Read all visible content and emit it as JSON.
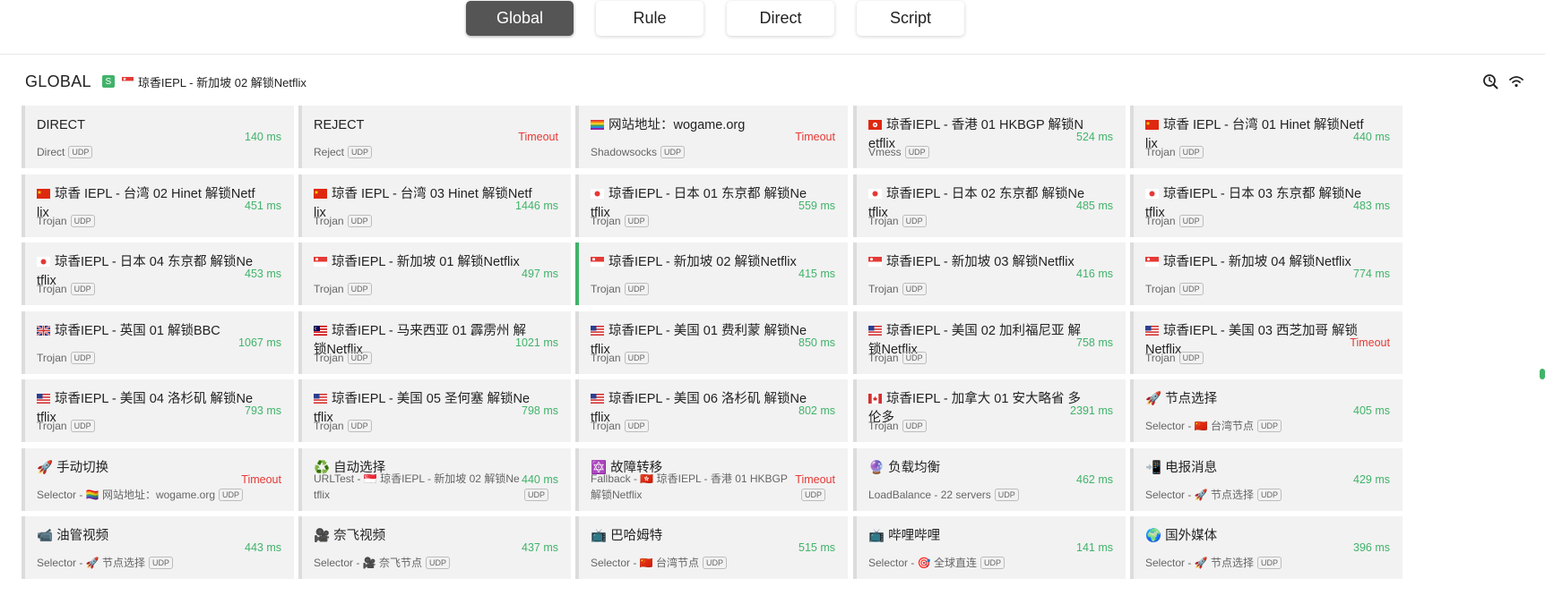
{
  "modes": {
    "tabs": [
      {
        "label": "Global",
        "active": true
      },
      {
        "label": "Rule",
        "active": false
      },
      {
        "label": "Direct",
        "active": false
      },
      {
        "label": "Script",
        "active": false
      }
    ]
  },
  "group": {
    "title": "GLOBAL",
    "type_badge": "S",
    "now_flag": "sg",
    "now": "琼香IEPL - 新加坡 02 解锁Netflix",
    "icons": [
      "check-delay-icon",
      "network-icon"
    ]
  },
  "colors": {
    "accent": "#41b36a",
    "timeout": "#e53935",
    "active_mode": "#555555"
  },
  "proxies": [
    {
      "name": "DIRECT",
      "flag": "",
      "info": "Direct",
      "delay": "140 ms",
      "timeout": false,
      "selected": false
    },
    {
      "name": "REJECT",
      "flag": "",
      "info": "Reject",
      "delay": "Timeout",
      "timeout": true,
      "selected": false
    },
    {
      "name": "网站地址：wogame.org",
      "flag": "rainbow",
      "info": "Shadowsocks",
      "delay": "Timeout",
      "timeout": true,
      "selected": false
    },
    {
      "name": "琼香IEPL - 香港 01 HKBGP 解锁Netflix",
      "flag": "hk",
      "info": "Vmess",
      "delay": "524 ms",
      "timeout": false,
      "selected": false
    },
    {
      "name": "琼香 IEPL - 台湾 01 Hinet 解锁Netflix",
      "flag": "cn",
      "info": "Trojan",
      "delay": "440 ms",
      "timeout": false,
      "selected": false
    },
    {
      "name": "琼香 IEPL - 台湾 02 Hinet 解锁Netflix",
      "flag": "cn",
      "info": "Trojan",
      "delay": "451 ms",
      "timeout": false,
      "selected": false
    },
    {
      "name": "琼香 IEPL - 台湾 03 Hinet 解锁Netflix",
      "flag": "cn",
      "info": "Trojan",
      "delay": "1446 ms",
      "timeout": false,
      "selected": false
    },
    {
      "name": "琼香IEPL - 日本 01 东京都 解锁Netflix",
      "flag": "jp",
      "info": "Trojan",
      "delay": "559 ms",
      "timeout": false,
      "selected": false
    },
    {
      "name": "琼香IEPL - 日本 02 东京都 解锁Netflix",
      "flag": "jp",
      "info": "Trojan",
      "delay": "485 ms",
      "timeout": false,
      "selected": false
    },
    {
      "name": "琼香IEPL - 日本 03 东京都 解锁Netflix",
      "flag": "jp",
      "info": "Trojan",
      "delay": "483 ms",
      "timeout": false,
      "selected": false
    },
    {
      "name": "琼香IEPL - 日本 04 东京都 解锁Netflix",
      "flag": "jp",
      "info": "Trojan",
      "delay": "453 ms",
      "timeout": false,
      "selected": false
    },
    {
      "name": "琼香IEPL - 新加坡 01 解锁Netflix",
      "flag": "sg",
      "info": "Trojan",
      "delay": "497 ms",
      "timeout": false,
      "selected": false
    },
    {
      "name": "琼香IEPL - 新加坡 02 解锁Netflix",
      "flag": "sg",
      "info": "Trojan",
      "delay": "415 ms",
      "timeout": false,
      "selected": true
    },
    {
      "name": "琼香IEPL - 新加坡 03 解锁Netflix",
      "flag": "sg",
      "info": "Trojan",
      "delay": "416 ms",
      "timeout": false,
      "selected": false
    },
    {
      "name": "琼香IEPL - 新加坡 04 解锁Netflix",
      "flag": "sg",
      "info": "Trojan",
      "delay": "774 ms",
      "timeout": false,
      "selected": false
    },
    {
      "name": "琼香IEPL - 英国 01 解锁BBC",
      "flag": "gb",
      "info": "Trojan",
      "delay": "1067 ms",
      "timeout": false,
      "selected": false
    },
    {
      "name": "琼香IEPL - 马来西亚 01 霹雳州 解锁Netflix",
      "flag": "my",
      "info": "Trojan",
      "delay": "1021 ms",
      "timeout": false,
      "selected": false
    },
    {
      "name": "琼香IEPL - 美国 01 费利蒙 解锁Netflix",
      "flag": "us",
      "info": "Trojan",
      "delay": "850 ms",
      "timeout": false,
      "selected": false
    },
    {
      "name": "琼香IEPL - 美国 02 加利福尼亚 解锁Netflix",
      "flag": "us",
      "info": "Trojan",
      "delay": "758 ms",
      "timeout": false,
      "selected": false
    },
    {
      "name": "琼香IEPL - 美国 03 西芝加哥 解锁Netflix",
      "flag": "us",
      "info": "Trojan",
      "delay": "Timeout",
      "timeout": true,
      "selected": false
    },
    {
      "name": "琼香IEPL - 美国 04 洛杉矶 解锁Netflix",
      "flag": "us",
      "info": "Trojan",
      "delay": "793 ms",
      "timeout": false,
      "selected": false
    },
    {
      "name": "琼香IEPL - 美国 05 圣何塞 解锁Netflix",
      "flag": "us",
      "info": "Trojan",
      "delay": "798 ms",
      "timeout": false,
      "selected": false
    },
    {
      "name": "琼香IEPL - 美国 06 洛杉矶 解锁Netflix",
      "flag": "us",
      "info": "Trojan",
      "delay": "802 ms",
      "timeout": false,
      "selected": false
    },
    {
      "name": "琼香IEPL - 加拿大 01 安大略省 多伦多",
      "flag": "ca",
      "info": "Trojan",
      "delay": "2391 ms",
      "timeout": false,
      "selected": false
    },
    {
      "name": "🚀 节点选择",
      "flag": "",
      "info": "Selector - 🇨🇳 台湾节点",
      "delay": "405 ms",
      "timeout": false,
      "selected": false
    },
    {
      "name": "🚀 手动切换",
      "flag": "",
      "info": "Selector - 🏳️‍🌈 网站地址：wogame.org",
      "delay": "Timeout",
      "timeout": true,
      "selected": false
    },
    {
      "name": "♻️ 自动选择",
      "flag": "",
      "info": "URLTest - 🇸🇬 琼香IEPL - 新加坡 02 解锁Netflix",
      "delay": "440 ms",
      "timeout": false,
      "selected": false
    },
    {
      "name": "🔯 故障转移",
      "flag": "",
      "info": "Fallback - 🇭🇰 琼香IEPL - 香港 01 HKBGP 解锁Netflix",
      "delay": "Timeout",
      "timeout": true,
      "selected": false
    },
    {
      "name": "🔮 负载均衡",
      "flag": "",
      "info": "LoadBalance - 22 servers",
      "delay": "462 ms",
      "timeout": false,
      "selected": false
    },
    {
      "name": "📲 电报消息",
      "flag": "",
      "info": "Selector - 🚀 节点选择",
      "delay": "429 ms",
      "timeout": false,
      "selected": false
    },
    {
      "name": "📹 油管视频",
      "flag": "",
      "info": "Selector - 🚀 节点选择",
      "delay": "443 ms",
      "timeout": false,
      "selected": false
    },
    {
      "name": "🎥 奈飞视频",
      "flag": "",
      "info": "Selector - 🎥 奈飞节点",
      "delay": "437 ms",
      "timeout": false,
      "selected": false
    },
    {
      "name": "📺 巴哈姆特",
      "flag": "",
      "info": "Selector - 🇨🇳 台湾节点",
      "delay": "515 ms",
      "timeout": false,
      "selected": false
    },
    {
      "name": "📺 哔哩哔哩",
      "flag": "",
      "info": "Selector - 🎯 全球直连",
      "delay": "141 ms",
      "timeout": false,
      "selected": false
    },
    {
      "name": "🌍 国外媒体",
      "flag": "",
      "info": "Selector - 🚀 节点选择",
      "delay": "396 ms",
      "timeout": false,
      "selected": false
    }
  ],
  "udp_label": "UDP"
}
